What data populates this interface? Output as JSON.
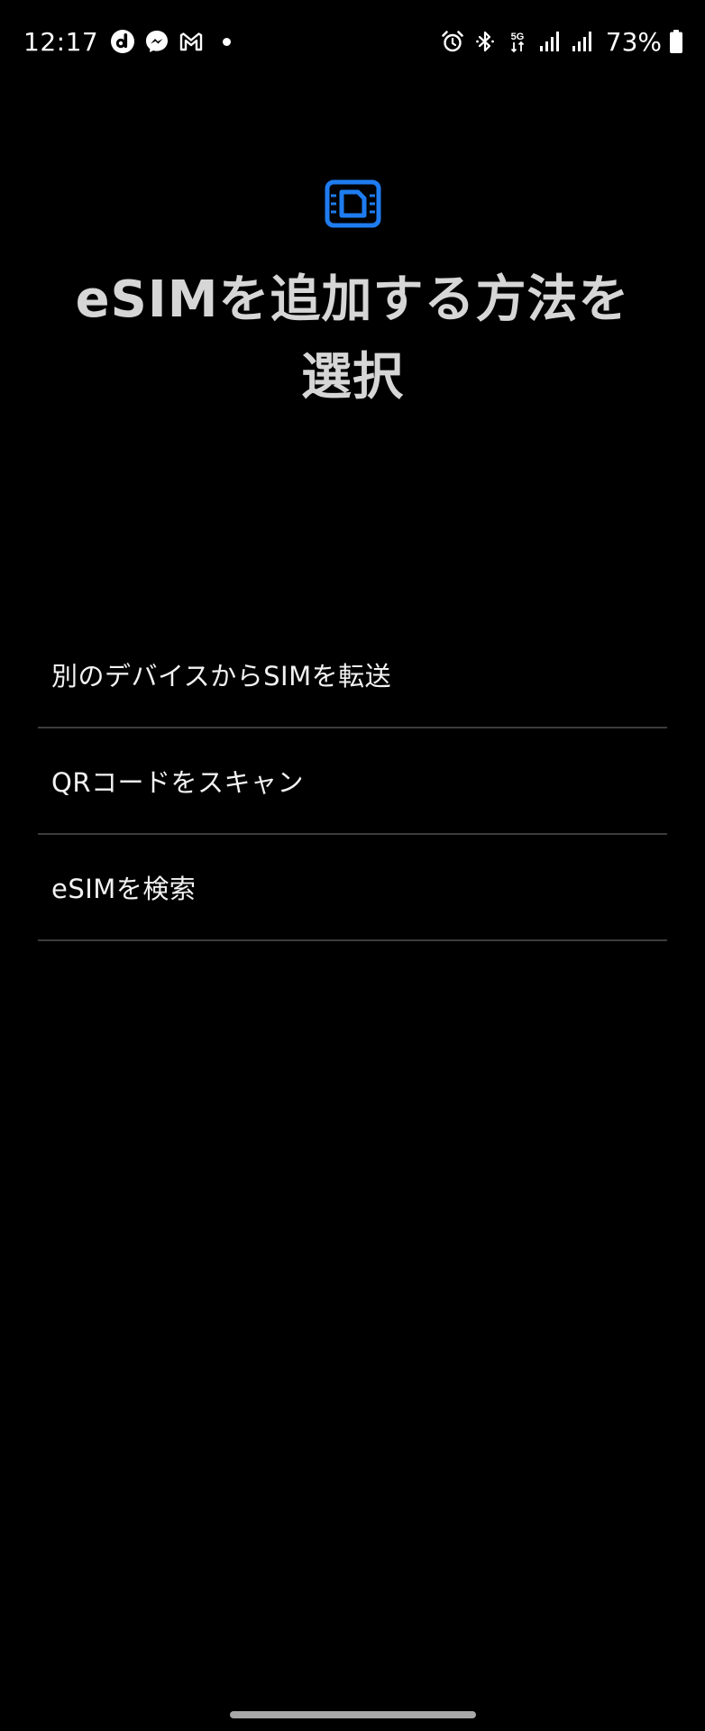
{
  "status_bar": {
    "time": "12:17",
    "notification_icons": [
      "docomo-d-icon",
      "messenger-icon",
      "gmail-icon",
      "more-notifications-dot"
    ],
    "system_icons": [
      "alarm-icon",
      "bluetooth-icon",
      "5g-data-icon",
      "signal-sim1-icon",
      "signal-sim2-icon"
    ],
    "network_type": "5G",
    "battery_percent": "73%"
  },
  "header": {
    "icon": "esim-chip-icon",
    "title": "eSIMを追加する方法を選択"
  },
  "options": [
    {
      "label": "別のデバイスからSIMを転送"
    },
    {
      "label": "QRコードをスキャン"
    },
    {
      "label": "eSIMを検索"
    }
  ],
  "colors": {
    "background": "#000000",
    "accent": "#1e7cf0",
    "title": "#d6d6d6",
    "divider": "#3c3c3c",
    "text": "#f2f2f2"
  }
}
